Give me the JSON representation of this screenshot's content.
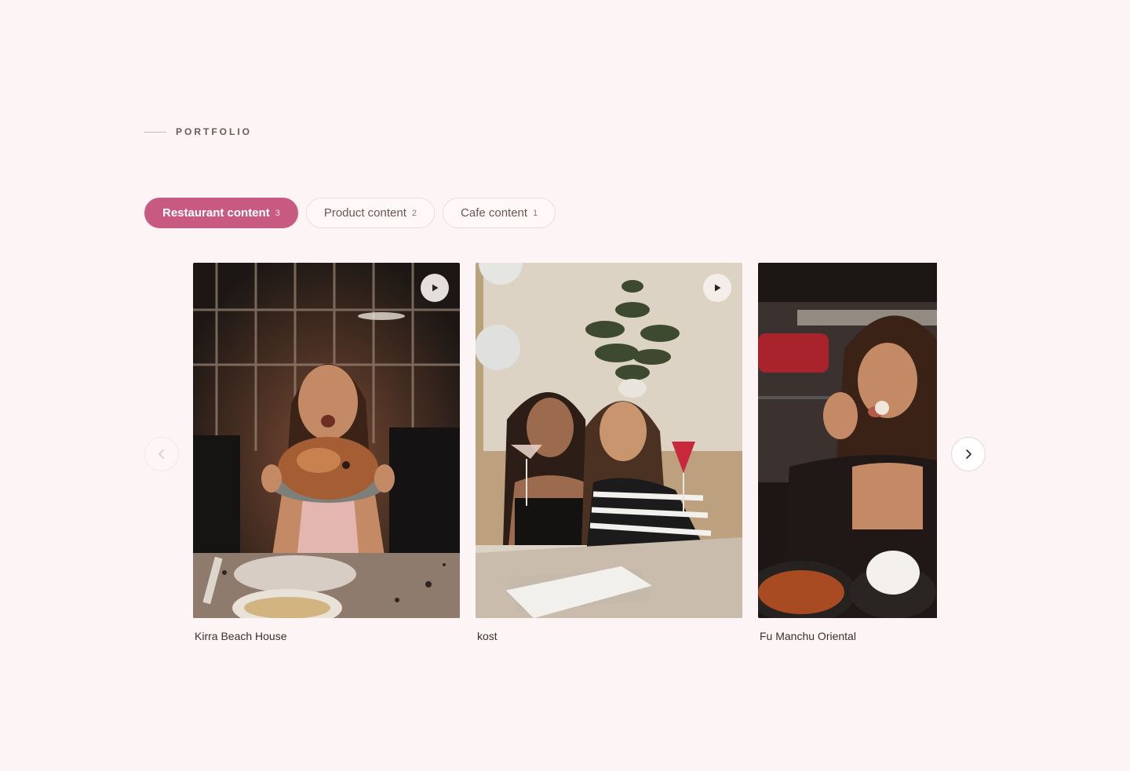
{
  "section": {
    "eyebrow": "PORTFOLIO"
  },
  "tabs": [
    {
      "label": "Restaurant content",
      "count": "3",
      "active": true
    },
    {
      "label": "Product content",
      "count": "2",
      "active": false
    },
    {
      "label": "Cafe content",
      "count": "1",
      "active": false
    }
  ],
  "cards": [
    {
      "title": "Kirra Beach House",
      "has_video": true,
      "play_icon": "play-icon"
    },
    {
      "title": "kost",
      "has_video": true,
      "play_icon": "play-icon"
    },
    {
      "title": "Fu Manchu Oriental",
      "has_video": false
    }
  ],
  "navigation": {
    "prev_icon": "chevron-left-icon",
    "next_icon": "chevron-right-icon"
  },
  "colors": {
    "background": "#fdf4f6",
    "accent": "#c85a82",
    "text": "#3a2e2c"
  }
}
